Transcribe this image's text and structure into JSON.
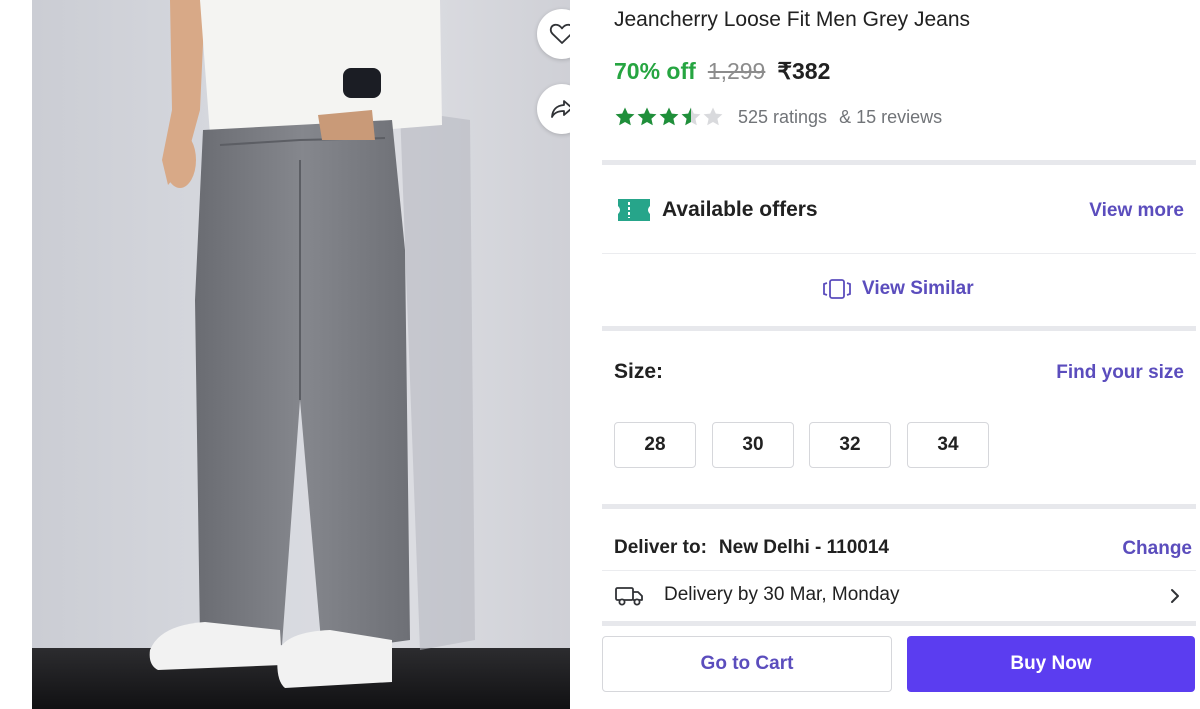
{
  "product": {
    "title": "Jeancherry Loose Fit Men Grey Jeans",
    "discount": "70% off",
    "mrp": "1,299",
    "price": "₹382",
    "rating_value": 3.5,
    "ratings_text": "525 ratings",
    "reviews_text": "& 15 reviews"
  },
  "image_actions": {
    "wishlist_icon": "heart-icon",
    "share_icon": "share-icon"
  },
  "offers": {
    "label": "Available offers",
    "link": "View more",
    "icon": "offer-ticket-icon"
  },
  "similar": {
    "label": "View Similar",
    "icon": "view-similar-icon"
  },
  "size": {
    "label": "Size:",
    "guide_link": "Find your size",
    "options": [
      "28",
      "30",
      "32",
      "34"
    ]
  },
  "delivery": {
    "deliver_to_label": "Deliver to:",
    "location": "New Delhi - 110014",
    "change_link": "Change",
    "estimate": "Delivery by 30 Mar, Monday",
    "icon": "truck-icon"
  },
  "actions": {
    "cart": "Go to Cart",
    "buy": "Buy Now"
  },
  "colors": {
    "discount_green": "#26a541",
    "link_purple": "#5b4dbd",
    "buy_button": "#5b3df0",
    "star_green": "#1f8f3a",
    "offer_icon": "#26a58a"
  }
}
